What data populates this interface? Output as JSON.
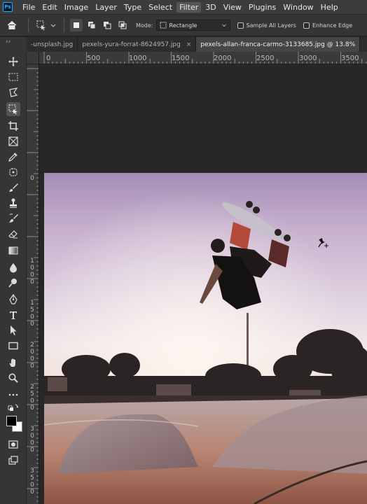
{
  "app": {
    "logo": "Ps"
  },
  "menu": [
    "File",
    "Edit",
    "Image",
    "Layer",
    "Type",
    "Select",
    "Filter",
    "3D",
    "View",
    "Plugins",
    "Window",
    "Help"
  ],
  "menu_active": "Filter",
  "options": {
    "mode_label": "Mode:",
    "mode_value": "Rectangle",
    "sample_all_layers": "Sample All Layers",
    "enhance_edge": "Enhance Edge"
  },
  "tabs": [
    {
      "label": "-unsplash.jpg",
      "active": false
    },
    {
      "label": "pexels-yura-forrat-8624957.jpg",
      "active": false
    },
    {
      "label": "pexels-allan-franca-carmo-3133685.jpg @ 13.8%",
      "active": true
    }
  ],
  "ruler_top": [
    "0",
    "500",
    "1000",
    "1500",
    "2000",
    "2500",
    "3000",
    "3500"
  ],
  "ruler_left": [
    "0",
    "1000",
    "1500",
    "2000",
    "2500",
    "3000",
    "3500"
  ],
  "tool_icons": [
    "move-icon",
    "marquee-icon",
    "lasso-icon",
    "object-selection-icon",
    "crop-icon",
    "frame-icon",
    "eyedropper-icon",
    "healing-icon",
    "brush-icon",
    "clone-stamp-icon",
    "history-brush-icon",
    "eraser-icon",
    "gradient-icon",
    "blur-icon",
    "dodge-icon",
    "pen-icon",
    "type-icon",
    "path-selection-icon",
    "rectangle-icon",
    "hand-icon",
    "zoom-icon",
    "more-tools-icon",
    "swap-colors-icon",
    "foreground-background-icon",
    "quick-mask-icon",
    "screen-mode-icon"
  ],
  "colors": {
    "foreground": "#000000",
    "background": "#ffffff",
    "accent": "#31a8ff"
  }
}
